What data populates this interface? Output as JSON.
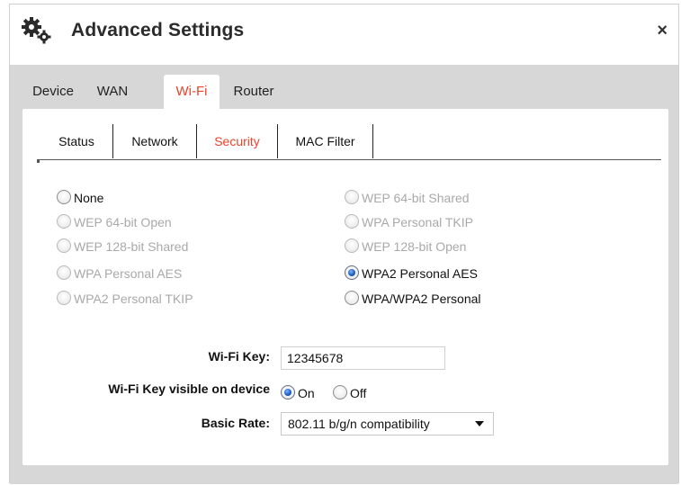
{
  "dialog": {
    "title": "Advanced Settings",
    "close_label": "×"
  },
  "main_tabs": [
    {
      "label": "Device",
      "active": false
    },
    {
      "label": "WAN",
      "active": false
    },
    {
      "label": "Wi-Fi",
      "active": true
    },
    {
      "label": "Router",
      "active": false
    }
  ],
  "sub_tabs": [
    {
      "label": "Status",
      "active": false
    },
    {
      "label": "Network",
      "active": false
    },
    {
      "label": "Security",
      "active": true
    },
    {
      "label": "MAC Filter",
      "active": false
    }
  ],
  "security_options": {
    "left": [
      {
        "label": "None",
        "enabled": true,
        "checked": false
      },
      {
        "label": "WEP 64-bit Open",
        "enabled": false,
        "checked": false
      },
      {
        "label": "WEP 128-bit Shared",
        "enabled": false,
        "checked": false
      },
      {
        "label": "WPA Personal AES",
        "enabled": false,
        "checked": false
      },
      {
        "label": "WPA2 Personal TKIP",
        "enabled": false,
        "checked": false
      }
    ],
    "right": [
      {
        "label": "WEP 64-bit Shared",
        "enabled": false,
        "checked": false
      },
      {
        "label": "WPA Personal TKIP",
        "enabled": false,
        "checked": false
      },
      {
        "label": "WEP 128-bit Open",
        "enabled": false,
        "checked": false
      },
      {
        "label": "WPA2 Personal AES",
        "enabled": true,
        "checked": true
      },
      {
        "label": "WPA/WPA2 Personal",
        "enabled": true,
        "checked": false
      }
    ]
  },
  "form": {
    "wifi_key_label": "Wi-Fi Key:",
    "wifi_key_value": "12345678",
    "key_visible_label": "Wi-Fi Key visible on device",
    "key_visible_on": "On",
    "key_visible_off": "Off",
    "key_visible_selected": "On",
    "basic_rate_label": "Basic Rate:",
    "basic_rate_value": "802.11 b/g/n compatibility"
  },
  "colors": {
    "accent": "#e8442b",
    "panel_bg": "#d7d7d7",
    "radio_selected": "#1f5fc4"
  }
}
